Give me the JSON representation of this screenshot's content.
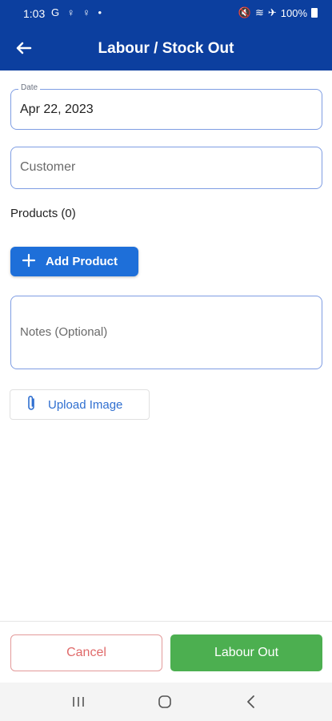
{
  "status_bar": {
    "time": "1:03",
    "notification_icons": "G ♀ ♀ •",
    "battery_text": "100%"
  },
  "app_bar": {
    "title": "Labour / Stock Out",
    "back_icon": "arrow-left-icon"
  },
  "form": {
    "date": {
      "label": "Date",
      "value": "Apr 22, 2023"
    },
    "customer": {
      "placeholder": "Customer"
    },
    "products_label": "Products (0)",
    "add_product_label": "Add Product",
    "notes": {
      "placeholder": "Notes (Optional)"
    },
    "upload_label": "Upload Image"
  },
  "actions": {
    "cancel_label": "Cancel",
    "submit_label": "Labour Out"
  },
  "colors": {
    "app_bar": "#0c3f9f",
    "primary_button": "#1e6fd9",
    "submit": "#4caf50",
    "cancel": "#e06a6a"
  },
  "icons": [
    "arrow-left-icon",
    "plus-icon",
    "paperclip-icon",
    "recents-icon",
    "home-icon",
    "back-icon"
  ]
}
